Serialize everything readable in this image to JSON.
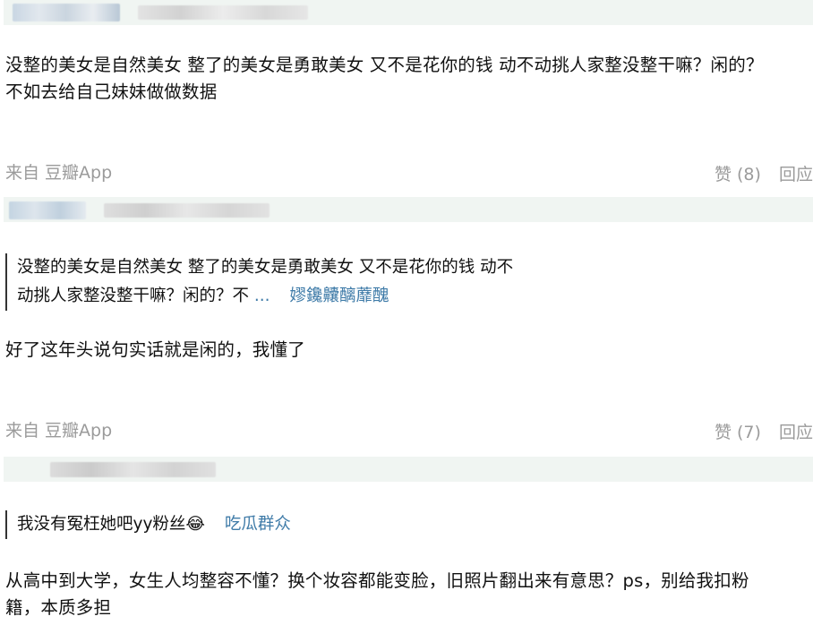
{
  "comments": [
    {
      "text_line1": "没整的美女是自然美女 整了的美女是勇敢美女 又不是花你的钱 动不动挑人家整没整干嘛？闲的？",
      "text_line2": "不如去给自己妹妹做做数据",
      "source": "来自 豆瓣App",
      "likes": "赞 (8)",
      "reply": "回应"
    },
    {
      "quote_line1": "没整的美女是自然美女 整了的美女是勇敢美女 又不是花你的钱 动不",
      "quote_line2": "动挑人家整没整干嘛？闲的？不",
      "quote_ellipsis": "...",
      "quote_author": "嫪鑱齉醨蘼醜",
      "text": "好了这年头说句实话就是闲的，我懂了",
      "source": "来自 豆瓣App",
      "likes": "赞 (7)",
      "reply": "回应"
    },
    {
      "quote_text": "我没有冤枉她吧yy粉丝😂",
      "quote_author": "吃瓜群众",
      "text_line1": "从高中到大学，女生人均整容不懂？换个妆容都能变脸，旧照片翻出来有意思？ps，别给我扣粉",
      "text_line2": "籍，本质多担"
    }
  ],
  "colors": {
    "header_bg": "#f0f5f2",
    "meta_text": "#9b9b9b",
    "link": "#3f7ba8",
    "text": "#111111"
  }
}
